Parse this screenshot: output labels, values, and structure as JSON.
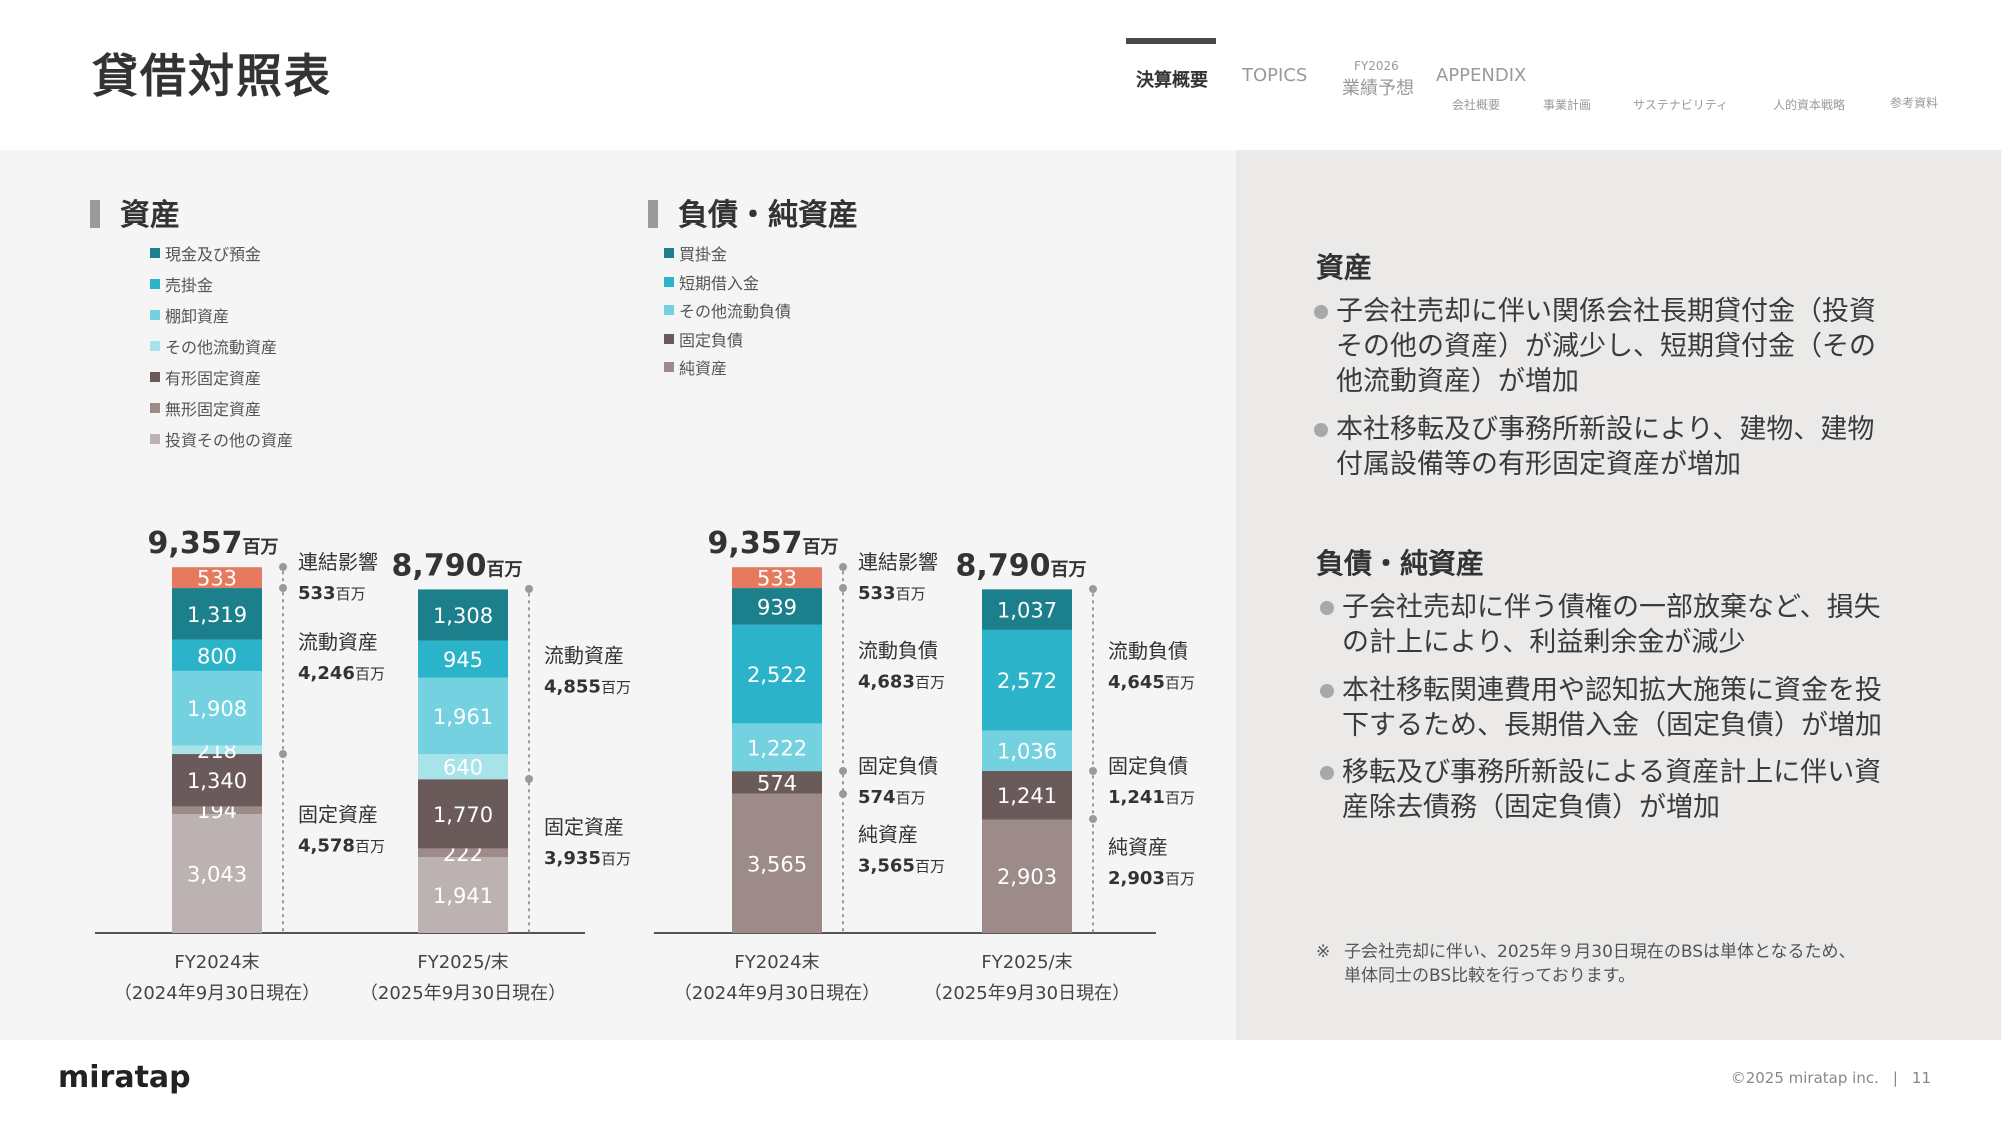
{
  "header": {
    "title": "貸借対照表",
    "nav": {
      "kessan": "決算概要",
      "topics": "TOPICS",
      "forecast_top": "FY2026",
      "forecast_bottom": "業績予想",
      "appendix": "APPENDIX",
      "sub": [
        "会社概要",
        "事業計画",
        "サステナビリティ",
        "人的資本戦略",
        "参考資料"
      ]
    }
  },
  "assets_section": {
    "heading": "資産",
    "legend": [
      {
        "label": "現金及び預金",
        "color": "#1c7f8c"
      },
      {
        "label": "売掛金",
        "color": "#2bb4c9"
      },
      {
        "label": "棚卸資産",
        "color": "#74d1df"
      },
      {
        "label": "その他流動資産",
        "color": "#a9e3ea"
      },
      {
        "label": "有形固定資産",
        "color": "#6a5a5a"
      },
      {
        "label": "無形固定資産",
        "color": "#9d8b8a"
      },
      {
        "label": "投資その他の資産",
        "color": "#bcb2b1"
      }
    ]
  },
  "liab_section": {
    "heading": "負債・純資産",
    "legend": [
      {
        "label": "買掛金",
        "color": "#1c7f8c"
      },
      {
        "label": "短期借入金",
        "color": "#2bb4c9"
      },
      {
        "label": "その他流動負債",
        "color": "#74d1df"
      },
      {
        "label": "固定負債",
        "color": "#6a5a5a"
      },
      {
        "label": "純資産",
        "color": "#9d8b8a"
      }
    ]
  },
  "chart_data": [
    {
      "type": "bar",
      "stacked": true,
      "title": "資産",
      "unit": "百万",
      "categories": [
        "FY2024末",
        "FY2025/末"
      ],
      "category_sub": [
        "（2024年9月30日現在）",
        "（2025年9月30日現在）"
      ],
      "totals": [
        "9,357",
        "8,790"
      ],
      "series": [
        {
          "name": "投資その他の資産",
          "values": [
            3043,
            1941
          ],
          "color": "#bcb2b1",
          "text_color": "#ffffff"
        },
        {
          "name": "無形固定資産",
          "values": [
            194,
            222
          ],
          "color": "#9d8b8a",
          "text_color": "#ffffff"
        },
        {
          "name": "有形固定資産",
          "values": [
            1340,
            1770
          ],
          "color": "#6a5a5a",
          "text_color": "#ffffff"
        },
        {
          "name": "その他流動資産",
          "values": [
            218,
            640
          ],
          "color": "#a9e3ea",
          "text_color": "#ffffff"
        },
        {
          "name": "棚卸資産",
          "values": [
            1908,
            1961
          ],
          "color": "#74d1df",
          "text_color": "#ffffff"
        },
        {
          "name": "売掛金",
          "values": [
            800,
            945
          ],
          "color": "#2bb4c9",
          "text_color": "#ffffff"
        },
        {
          "name": "現金及び預金",
          "values": [
            1319,
            1308
          ],
          "color": "#1c7f8c",
          "text_color": "#ffffff"
        },
        {
          "name": "連結影響",
          "values": [
            533,
            0
          ],
          "color": "#e57a5f",
          "text_color": "#ffffff"
        }
      ],
      "value_labels": [
        [
          "3,043",
          "194",
          "1,340",
          "218",
          "1,908",
          "800",
          "1,319",
          "533"
        ],
        [
          "1,941",
          "222",
          "1,770",
          "640",
          "1,961",
          "945",
          "1,308",
          ""
        ]
      ],
      "brackets": [
        [
          {
            "label": "連結影響",
            "value": "533",
            "from": 7,
            "to": 7
          },
          {
            "label": "流動資産",
            "value": "4,246",
            "from": 3,
            "to": 6
          },
          {
            "label": "固定資産",
            "value": "4,578",
            "from": 0,
            "to": 2
          }
        ],
        [
          {
            "label": "流動資産",
            "value": "4,855",
            "from": 3,
            "to": 6
          },
          {
            "label": "固定資産",
            "value": "3,935",
            "from": 0,
            "to": 2
          }
        ]
      ]
    },
    {
      "type": "bar",
      "stacked": true,
      "title": "負債・純資産",
      "unit": "百万",
      "categories": [
        "FY2024末",
        "FY2025/末"
      ],
      "category_sub": [
        "（2024年9月30日現在）",
        "（2025年9月30日現在）"
      ],
      "totals": [
        "9,357",
        "8,790"
      ],
      "series": [
        {
          "name": "純資産",
          "values": [
            3565,
            2903
          ],
          "color": "#9d8b8a",
          "text_color": "#ffffff"
        },
        {
          "name": "固定負債",
          "values": [
            574,
            1241
          ],
          "color": "#6a5a5a",
          "text_color": "#ffffff"
        },
        {
          "name": "その他流動負債",
          "values": [
            1222,
            1036
          ],
          "color": "#74d1df",
          "text_color": "#ffffff"
        },
        {
          "name": "短期借入金",
          "values": [
            2522,
            2572
          ],
          "color": "#2bb4c9",
          "text_color": "#ffffff"
        },
        {
          "name": "買掛金",
          "values": [
            939,
            1037
          ],
          "color": "#1c7f8c",
          "text_color": "#ffffff"
        },
        {
          "name": "連結影響",
          "values": [
            533,
            0
          ],
          "color": "#e57a5f",
          "text_color": "#ffffff"
        }
      ],
      "value_labels": [
        [
          "3,565",
          "574",
          "1,222",
          "2,522",
          "939",
          "533"
        ],
        [
          "2,903",
          "1,241",
          "1,036",
          "2,572",
          "1,037",
          ""
        ]
      ],
      "brackets": [
        [
          {
            "label": "連結影響",
            "value": "533",
            "from": 5,
            "to": 5
          },
          {
            "label": "流動負債",
            "value": "4,683",
            "from": 2,
            "to": 4
          },
          {
            "label": "固定負債",
            "value": "574",
            "from": 1,
            "to": 1
          },
          {
            "label": "純資産",
            "value": "3,565",
            "from": 0,
            "to": 0
          }
        ],
        [
          {
            "label": "流動負債",
            "value": "4,645",
            "from": 2,
            "to": 4
          },
          {
            "label": "固定負債",
            "value": "1,241",
            "from": 1,
            "to": 1
          },
          {
            "label": "純資産",
            "value": "2,903",
            "from": 0,
            "to": 0
          }
        ]
      ]
    }
  ],
  "commentary": {
    "assets_title": "資産",
    "assets_bullets": [
      [
        "子会社売却に伴い関係会社長期貸付金（投資",
        "その他の資産）が減少し、短期貸付金（その",
        "他流動資産）が増加"
      ],
      [
        "本社移転及び事務所新設により、建物、建物",
        "付属設備等の有形固定資産が増加"
      ]
    ],
    "liab_title": "負債・純資産",
    "liab_bullets": [
      [
        "子会社売却に伴う債権の一部放棄など、損失",
        "の計上により、利益剰余金が減少"
      ],
      [
        "本社移転関連費用や認知拡大施策に資金を投",
        "下するため、長期借入金（固定負債）が増加"
      ],
      [
        "移転及び事務所新設による資産計上に伴い資",
        "産除去債務（固定負債）が増加"
      ]
    ],
    "note_mark": "※",
    "note_lines": [
      "子会社売却に伴い、2025年９月30日現在のBSは単体となるため、",
      "単体同士のBS比較を行っております。"
    ]
  },
  "footer": {
    "logo": "miratap",
    "copyright": "©2025 miratap inc.",
    "separator": "|",
    "page": "11"
  }
}
